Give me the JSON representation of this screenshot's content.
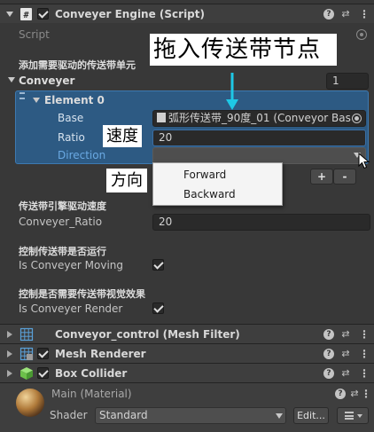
{
  "component": {
    "title": "Conveyer Engine (Script)",
    "script_label": "Script"
  },
  "sections": {
    "header1": "添加需要驱动的传送带单元",
    "header2": "传送带引擎驱动速度",
    "header3": "控制传送带是否运行",
    "header4": "控制是否需要传送带视觉效果"
  },
  "conveyer": {
    "label": "Conveyer",
    "size": "1",
    "element_label": "Element 0",
    "base_label": "Base",
    "base_value": "弧形传送带_90度_01 (Conveyor Bas",
    "ratio_label": "Ratio",
    "ratio_value": "20",
    "direction_label": "Direction",
    "direction_value": "",
    "add_label": "+",
    "remove_label": "-"
  },
  "dropdown": {
    "options": [
      "Forward",
      "Backward"
    ]
  },
  "ratio": {
    "label": "Conveyer_Ratio",
    "value": "20"
  },
  "moving": {
    "label": "Is Conveyer Moving",
    "checked": true
  },
  "render": {
    "label": "Is Conveyer Render",
    "checked": true
  },
  "components": [
    {
      "title": "Conveyor_control (Mesh Filter)"
    },
    {
      "title": "Mesh Renderer"
    },
    {
      "title": "Box Collider"
    }
  ],
  "material": {
    "title": "Main (Material)",
    "shader_label": "Shader",
    "shader_value": "Standard",
    "edit_label": "Edit..."
  },
  "annotations": {
    "drag_note": "拖入传送带节点",
    "speed_note": "速度",
    "direction_note": "方向"
  },
  "colors": {
    "accent": "#2d5a83",
    "annotation_arrow": "#1ec8e6"
  }
}
